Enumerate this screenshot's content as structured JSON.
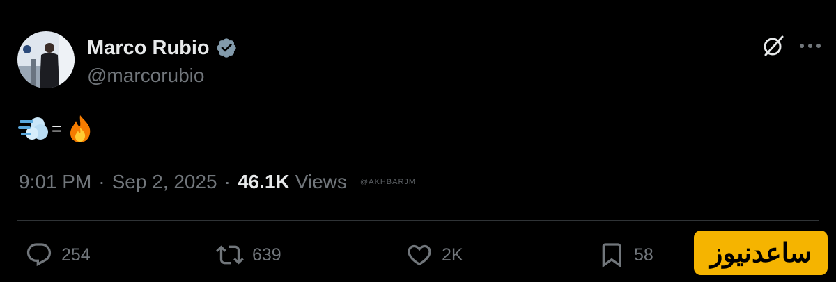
{
  "author": {
    "display_name": "Marco Rubio",
    "handle": "@marcorubio",
    "verified": true,
    "verified_color": "#829aab"
  },
  "tweet": {
    "content_emojis": [
      "dashing-away-emoji",
      "fire-emoji"
    ],
    "content_symbol": "="
  },
  "meta": {
    "time": "9:01 PM",
    "separator": "·",
    "date": "Sep 2, 2025",
    "views_count": "46.1K",
    "views_label": "Views"
  },
  "watermark_small": "@AKHBARJM",
  "actions": {
    "replies": "254",
    "reposts": "639",
    "likes": "2K",
    "bookmarks": "58"
  },
  "logo": {
    "text": "ساعدنیوز",
    "background": "#f5b400"
  },
  "colors": {
    "background": "#000000",
    "primary_text": "#e7e9ea",
    "secondary_text": "#71767b",
    "divider": "#2f3336"
  }
}
